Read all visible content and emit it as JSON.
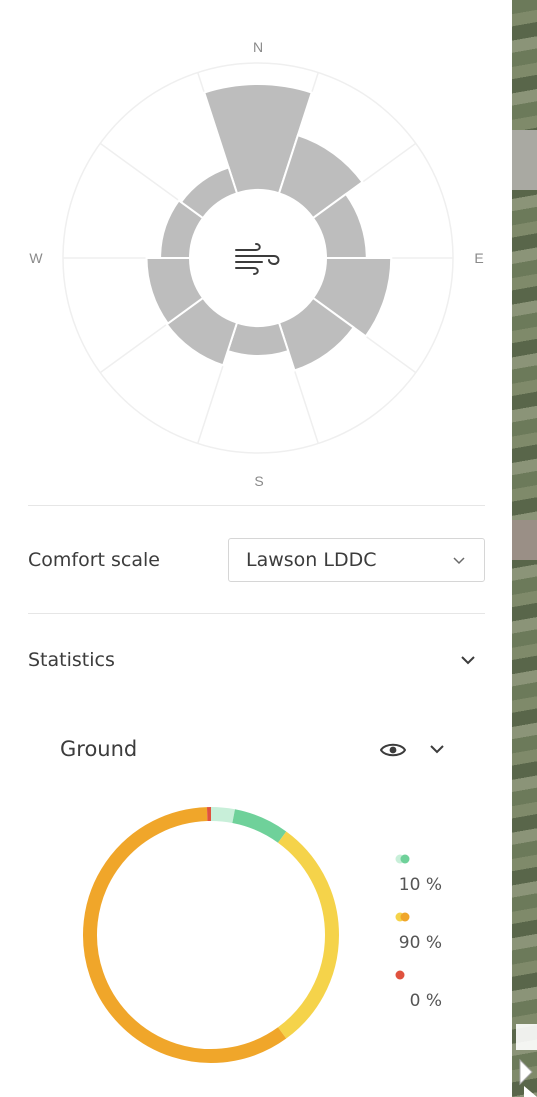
{
  "compass": {
    "north": "N",
    "east": "E",
    "south": "S",
    "west": "W"
  },
  "wind_rose": {
    "icon": "wind-icon",
    "sectors": [
      {
        "direction": "N",
        "level": 0.78
      },
      {
        "direction": "NNE",
        "level": 0.45
      },
      {
        "direction": "ENE",
        "level": 0.3
      },
      {
        "direction": "ESE",
        "level": 0.48
      },
      {
        "direction": "SSE",
        "level": 0.37
      },
      {
        "direction": "S",
        "level": 0.22
      },
      {
        "direction": "SSW",
        "level": 0.33
      },
      {
        "direction": "WSW",
        "level": 0.32
      },
      {
        "direction": "WNW",
        "level": 0.22
      },
      {
        "direction": "NNW",
        "level": 0.2
      }
    ],
    "sector_color": "#bdbdbd"
  },
  "comfort_scale": {
    "label": "Comfort scale",
    "selected": "Lawson LDDC"
  },
  "statistics": {
    "label": "Statistics",
    "ground": {
      "label": "Ground",
      "legend": [
        {
          "value": "10 %",
          "colors": [
            "#c8efd9",
            "#6fd19a"
          ]
        },
        {
          "value": "90 %",
          "colors": [
            "#f5d34a",
            "#f0a62a"
          ]
        },
        {
          "value": "0 %",
          "colors": [
            "#e0523e"
          ]
        }
      ]
    }
  },
  "donut": {
    "segments": [
      {
        "fraction": 0.03,
        "color": "#c8efd9"
      },
      {
        "fraction": 0.07,
        "color": "#6fd19a"
      },
      {
        "fraction": 0.3,
        "color": "#f5d34a"
      },
      {
        "fraction": 0.595,
        "color": "#f0a62a"
      },
      {
        "fraction": 0.005,
        "color": "#e0523e"
      }
    ]
  },
  "colors": {
    "accent_red": "#e01e1e",
    "text": "#3c3c3c",
    "muted": "#8a8a8a"
  }
}
